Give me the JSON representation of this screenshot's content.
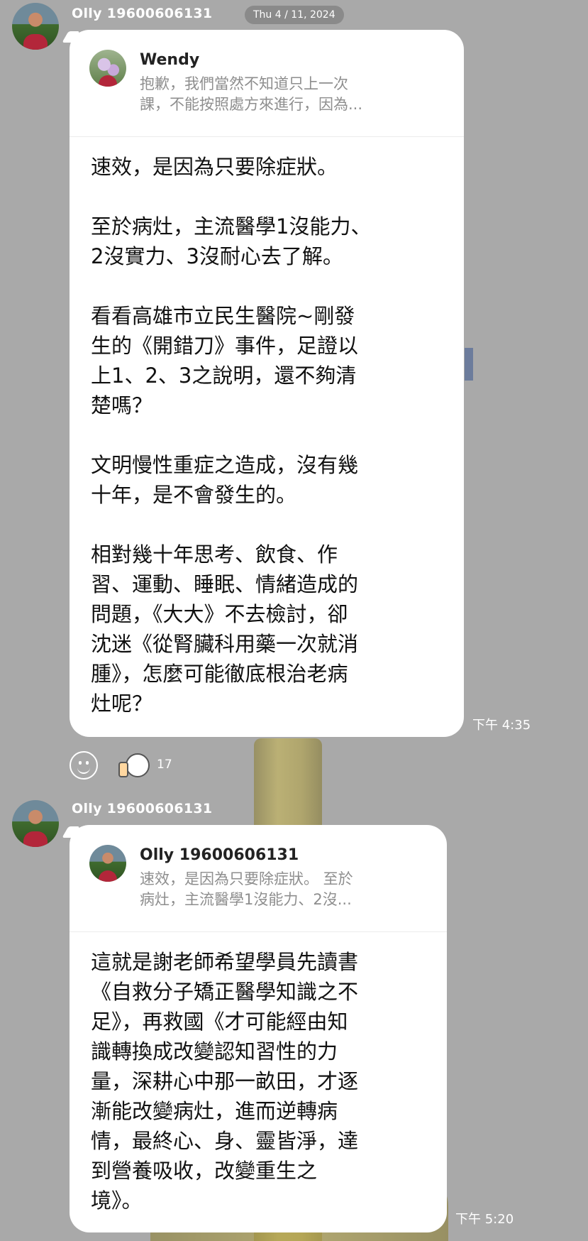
{
  "messages": [
    {
      "sender": "Olly 19600606131",
      "date_pill": "Thu 4 / 11, 2024",
      "reply": {
        "name": "Wendy",
        "lines": [
          "抱歉，我們當然不知道只上一次",
          "課，不能按照處方來進行，因為..."
        ]
      },
      "body_lines": [
        "速效，是因為只要除症狀。",
        "",
        "至於病灶，主流醫學1沒能力、",
        "2沒實力、3沒耐心去了解。",
        "",
        "看看高雄市立民生醫院~剛發",
        "生的《開錯刀》事件，足證以",
        "上1、2、3之說明，還不夠清",
        "楚嗎？",
        "",
        "文明慢性重症之造成，沒有幾",
        "十年，是不會發生的。",
        "",
        "相對幾十年思考、飲食、作",
        "習、運動、睡眠、情緒造成的",
        "問題，《大大》不去檢討，卻",
        "沈迷《從腎臟科用藥一次就消",
        "腫》，怎麼可能徹底根治老病",
        "灶呢？"
      ],
      "time": "下午 4:35",
      "reaction_count": "17"
    },
    {
      "sender": "Olly 19600606131",
      "reply": {
        "name": "Olly 19600606131",
        "lines": [
          "速效，是因為只要除症狀。 至於",
          "病灶，主流醫學1沒能力、2沒..."
        ]
      },
      "body_lines": [
        "這就是謝老師希望學員先讀書",
        "《自救分子矯正醫學知識之不",
        "足》，再救國《才可能經由知",
        "識轉換成改變認知習性的力",
        "量，深耕心中那一畝田，才逐",
        "漸能改變病灶，進而逆轉病",
        "情，最終心、身、靈皆淨，達",
        "到營養吸收，改變重生之",
        "境》。"
      ],
      "time": "下午 5:20"
    }
  ],
  "icons": {
    "react_button": "smiley-outline-icon",
    "reaction_sticker": "thumbs-up-face-icon"
  },
  "colors": {
    "chat_background": "#a9a9a9",
    "bubble": "#ffffff",
    "meta_text": "#ffffff",
    "reply_preview_text": "#8e8e8e"
  }
}
